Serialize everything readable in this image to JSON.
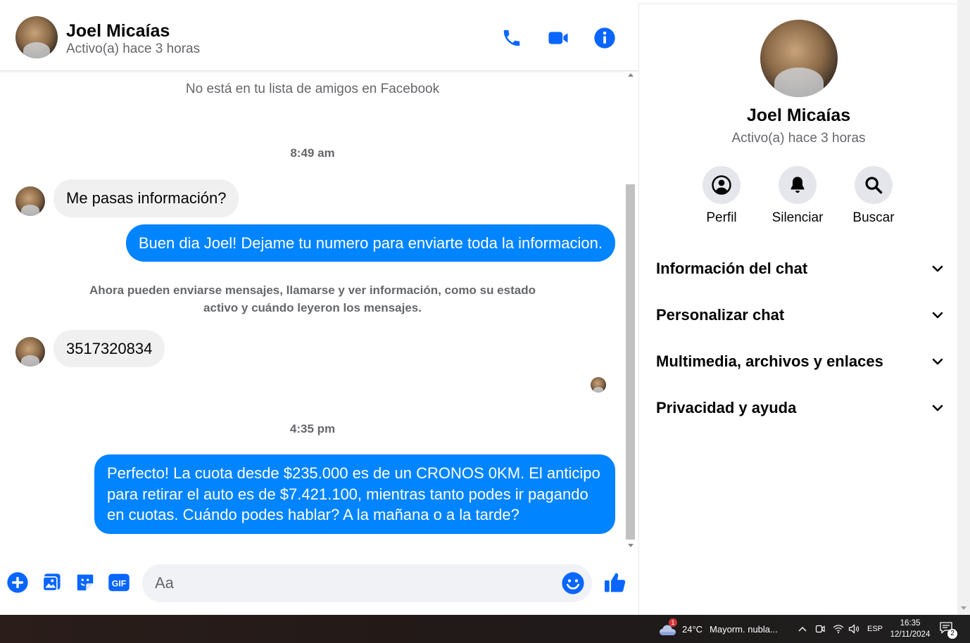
{
  "contact": {
    "name": "Joel Micaías",
    "status": "Activo(a) hace 3 horas"
  },
  "colors": {
    "accent": "#0084ff",
    "icon_blue": "#0866ff",
    "incoming_bubble": "#f0f0f0",
    "muted_text": "#65676b"
  },
  "header": {
    "call_icon": "phone-icon",
    "video_icon": "video-camera-icon",
    "info_icon": "info-icon"
  },
  "conversation": {
    "not_friends_note": "No está en tu lista de amigos en Facebook",
    "time_1": "8:49 am",
    "incoming_1": "Me pasas información?",
    "outgoing_1": "Buen dia Joel! Dejame tu numero para enviarte toda la informacion.",
    "system_note_line_1": "Ahora pueden enviarse mensajes, llamarse y ver información, como su estado",
    "system_note_line_2": "activo y cuándo leyeron los mensajes.",
    "incoming_2": "3517320834",
    "time_2": "4:35 pm",
    "outgoing_2": "Perfecto! La cuota desde $235.000 es de un CRONOS 0KM. El anticipo para retirar el auto es de $7.421.100, mientras tanto podes ir pagando en cuotas. Cuándo podes hablar? A la mañana o a la tarde?"
  },
  "composer": {
    "placeholder": "Aa",
    "gif_label": "GIF"
  },
  "info_pane": {
    "actions": [
      {
        "label": "Perfil",
        "icon": "profile-icon"
      },
      {
        "label": "Silenciar",
        "icon": "bell-icon"
      },
      {
        "label": "Buscar",
        "icon": "search-icon"
      }
    ],
    "sections": [
      {
        "label": "Información del chat"
      },
      {
        "label": "Personalizar chat"
      },
      {
        "label": "Multimedia, archivos y enlaces"
      },
      {
        "label": "Privacidad y ayuda"
      }
    ]
  },
  "taskbar": {
    "weather_alert_count": "1",
    "temperature": "24°C",
    "weather_desc": "Mayorm. nubla...",
    "language": "ESP",
    "time": "16:35",
    "date": "12/11/2024",
    "notification_count": "2"
  }
}
